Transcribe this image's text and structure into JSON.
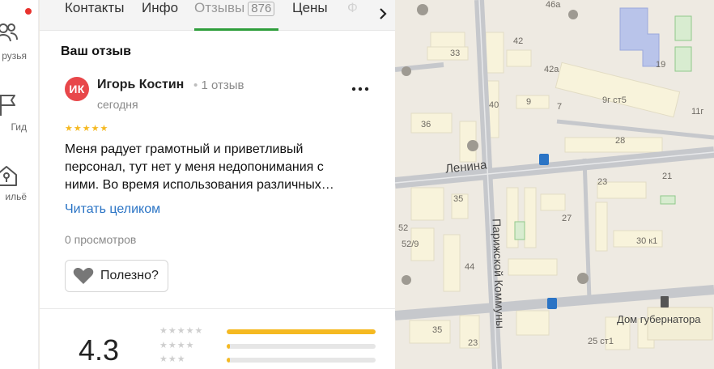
{
  "rail": {
    "items": [
      {
        "label": "рузья",
        "icon": "friends-icon"
      },
      {
        "label": "Гид",
        "icon": "guide-flag-icon"
      },
      {
        "label": "ильё",
        "icon": "housing-icon"
      }
    ],
    "notification_color": "#e8322d"
  },
  "tabs": [
    {
      "label": "Контакты"
    },
    {
      "label": "Инфо"
    },
    {
      "label": "Отзывы",
      "count": "876",
      "active": true
    },
    {
      "label": "Цены"
    },
    {
      "label": "Ф"
    }
  ],
  "review": {
    "section_title": "Ваш отзыв",
    "avatar_initials": "ИК",
    "avatar_color": "#e8474a",
    "author": "Игорь Костин",
    "author_meta": "1 отзыв",
    "date": "сегодня",
    "stars": 5,
    "text": "Меня радует грамотный и приветливый персонал, тут нет у меня недопонимания с ними. Во время использования различных…",
    "read_more": "Читать целиком",
    "views": "0 просмотров",
    "helpful": "Полезно?"
  },
  "rating": {
    "value": "4.3",
    "distribution": [
      {
        "stars": 5,
        "fraction": 1.0
      },
      {
        "stars": 4,
        "fraction": 0.02
      },
      {
        "stars": 3,
        "fraction": 0.02
      }
    ],
    "accent_color": "#f5b921"
  },
  "map": {
    "streets": [
      "Ленина",
      "Парижской Коммуны"
    ],
    "poi": "Дом губернатора",
    "labels": [
      "46а",
      "42",
      "42а",
      "33",
      "40",
      "9",
      "7",
      "9г ст5",
      "19",
      "11г",
      "36",
      "28",
      "23",
      "21",
      "35",
      "27",
      "52",
      "52/9",
      "44",
      "30 к1",
      "35",
      "25 ст1",
      "23"
    ]
  },
  "colors": {
    "active_tab_underline": "#2e9e3b",
    "link": "#2b74c5",
    "map_background": "#eeeae2",
    "map_road": "#c7c9cc",
    "map_building": "#f8f3db"
  }
}
